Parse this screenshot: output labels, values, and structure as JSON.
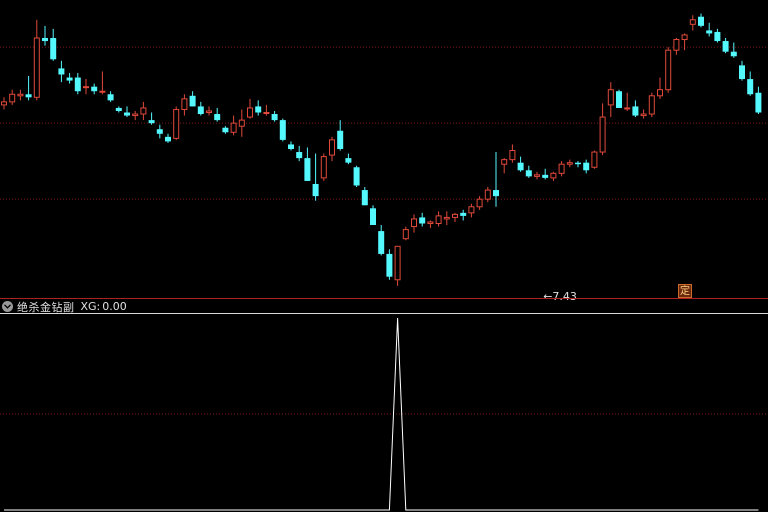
{
  "theme": {
    "background": "#000000",
    "up_color": "#e0493a",
    "down_color": "#54f8ff",
    "grid_color": "#7a1a1a",
    "separator_color": "#b02020",
    "signal_color": "#ffffff"
  },
  "indicator": {
    "icon": "chevron-down-icon",
    "name": "绝杀金钻副",
    "value_label": "XG:",
    "value": "0.00"
  },
  "marker": {
    "label": "定"
  },
  "chart_data": [
    {
      "type": "candlestick",
      "annotation": {
        "text": "←7.43",
        "low_value": 7.43,
        "bar_index": 66
      },
      "ohlc": [
        [
          8.62,
          8.67,
          8.59,
          8.64
        ],
        [
          8.64,
          8.72,
          8.62,
          8.69
        ],
        [
          8.68,
          8.72,
          8.65,
          8.69
        ],
        [
          8.69,
          8.81,
          8.65,
          8.67
        ],
        [
          8.67,
          9.18,
          8.65,
          9.06
        ],
        [
          9.06,
          9.14,
          9.01,
          9.04
        ],
        [
          9.06,
          9.12,
          8.91,
          8.92
        ],
        [
          8.86,
          8.91,
          8.77,
          8.82
        ],
        [
          8.8,
          8.83,
          8.76,
          8.78
        ],
        [
          8.8,
          8.83,
          8.69,
          8.71
        ],
        [
          8.74,
          8.79,
          8.69,
          8.74
        ],
        [
          8.74,
          8.76,
          8.69,
          8.71
        ],
        [
          8.71,
          8.84,
          8.69,
          8.71
        ],
        [
          8.69,
          8.71,
          8.64,
          8.65
        ],
        [
          8.6,
          8.61,
          8.57,
          8.58
        ],
        [
          8.57,
          8.61,
          8.54,
          8.55
        ],
        [
          8.55,
          8.58,
          8.52,
          8.56
        ],
        [
          8.56,
          8.64,
          8.52,
          8.6
        ],
        [
          8.52,
          8.57,
          8.49,
          8.5
        ],
        [
          8.46,
          8.49,
          8.4,
          8.43
        ],
        [
          8.41,
          8.43,
          8.37,
          8.38
        ],
        [
          8.4,
          8.61,
          8.39,
          8.59
        ],
        [
          8.59,
          8.69,
          8.55,
          8.66
        ],
        [
          8.68,
          8.71,
          8.61,
          8.61
        ],
        [
          8.61,
          8.64,
          8.55,
          8.56
        ],
        [
          8.57,
          8.61,
          8.55,
          8.58
        ],
        [
          8.56,
          8.6,
          8.51,
          8.52
        ],
        [
          8.47,
          8.48,
          8.43,
          8.44
        ],
        [
          8.44,
          8.55,
          8.42,
          8.5
        ],
        [
          8.48,
          8.59,
          8.41,
          8.52
        ],
        [
          8.54,
          8.66,
          8.53,
          8.6
        ],
        [
          8.61,
          8.65,
          8.55,
          8.57
        ],
        [
          8.57,
          8.62,
          8.55,
          8.57
        ],
        [
          8.56,
          8.58,
          8.51,
          8.52
        ],
        [
          8.52,
          8.53,
          8.38,
          8.39
        ],
        [
          8.36,
          8.38,
          8.32,
          8.33
        ],
        [
          8.31,
          8.35,
          8.25,
          8.27
        ],
        [
          8.27,
          8.34,
          8.12,
          8.12
        ],
        [
          8.1,
          8.3,
          7.99,
          8.02
        ],
        [
          8.14,
          8.3,
          8.12,
          8.28
        ],
        [
          8.29,
          8.41,
          8.25,
          8.39
        ],
        [
          8.45,
          8.52,
          8.32,
          8.33
        ],
        [
          8.27,
          8.3,
          8.23,
          8.24
        ],
        [
          8.21,
          8.22,
          8.08,
          8.09
        ],
        [
          8.06,
          8.08,
          7.96,
          7.96
        ],
        [
          7.94,
          7.96,
          7.83,
          7.83
        ],
        [
          7.79,
          7.83,
          7.63,
          7.64
        ],
        [
          7.64,
          7.67,
          7.47,
          7.49
        ],
        [
          7.47,
          7.69,
          7.43,
          7.69
        ],
        [
          7.74,
          7.82,
          7.73,
          7.8
        ],
        [
          7.82,
          7.9,
          7.78,
          7.87
        ],
        [
          7.88,
          7.91,
          7.82,
          7.84
        ],
        [
          7.84,
          7.86,
          7.81,
          7.85
        ],
        [
          7.84,
          7.92,
          7.82,
          7.89
        ],
        [
          7.87,
          7.92,
          7.83,
          7.88
        ],
        [
          7.88,
          7.91,
          7.85,
          7.9
        ],
        [
          7.91,
          7.93,
          7.86,
          7.89
        ],
        [
          7.91,
          7.97,
          7.88,
          7.95
        ],
        [
          7.95,
          8.02,
          7.93,
          8.0
        ],
        [
          8.0,
          8.08,
          7.98,
          8.06
        ],
        [
          8.06,
          8.31,
          7.95,
          8.02
        ],
        [
          8.23,
          8.27,
          8.17,
          8.26
        ],
        [
          8.26,
          8.36,
          8.24,
          8.32
        ],
        [
          8.24,
          8.28,
          8.18,
          8.19
        ],
        [
          8.19,
          8.22,
          8.14,
          8.15
        ],
        [
          8.15,
          8.18,
          8.13,
          8.16
        ],
        [
          8.16,
          8.2,
          8.13,
          8.14
        ],
        [
          8.14,
          8.18,
          8.12,
          8.17
        ],
        [
          8.17,
          8.25,
          8.15,
          8.23
        ],
        [
          8.23,
          8.26,
          8.21,
          8.24
        ],
        [
          8.24,
          8.25,
          8.21,
          8.23
        ],
        [
          8.24,
          8.26,
          8.17,
          8.19
        ],
        [
          8.21,
          8.32,
          8.2,
          8.31
        ],
        [
          8.31,
          8.63,
          8.29,
          8.54
        ],
        [
          8.62,
          8.77,
          8.54,
          8.72
        ],
        [
          8.71,
          8.72,
          8.6,
          8.6
        ],
        [
          8.6,
          8.7,
          8.58,
          8.6
        ],
        [
          8.61,
          8.65,
          8.54,
          8.55
        ],
        [
          8.55,
          8.59,
          8.53,
          8.56
        ],
        [
          8.56,
          8.7,
          8.54,
          8.68
        ],
        [
          8.68,
          8.8,
          8.66,
          8.72
        ],
        [
          8.72,
          9.0,
          8.7,
          8.98
        ],
        [
          8.98,
          9.06,
          8.95,
          9.05
        ],
        [
          9.05,
          9.09,
          8.98,
          9.08
        ],
        [
          9.15,
          9.21,
          9.11,
          9.18
        ],
        [
          9.2,
          9.22,
          9.13,
          9.14
        ],
        [
          9.11,
          9.16,
          9.07,
          9.09
        ],
        [
          9.1,
          9.12,
          9.03,
          9.04
        ],
        [
          9.04,
          9.06,
          8.96,
          8.97
        ],
        [
          8.97,
          9.03,
          8.93,
          8.94
        ],
        [
          8.88,
          8.91,
          8.78,
          8.79
        ],
        [
          8.79,
          8.84,
          8.68,
          8.69
        ],
        [
          8.7,
          8.74,
          8.56,
          8.57
        ]
      ],
      "ylim": [
        7.35,
        9.31
      ],
      "grid_values": [
        8.0,
        8.5,
        9.0
      ]
    },
    {
      "type": "line",
      "name": "XG",
      "values": [
        0,
        0,
        0,
        0,
        0,
        0,
        0,
        0,
        0,
        0,
        0,
        0,
        0,
        0,
        0,
        0,
        0,
        0,
        0,
        0,
        0,
        0,
        0,
        0,
        0,
        0,
        0,
        0,
        0,
        0,
        0,
        0,
        0,
        0,
        0,
        0,
        0,
        0,
        0,
        0,
        0,
        0,
        0,
        0,
        0,
        0,
        0,
        0,
        1,
        0,
        0,
        0,
        0,
        0,
        0,
        0,
        0,
        0,
        0,
        0,
        0,
        0,
        0,
        0,
        0,
        0,
        0,
        0,
        0,
        0,
        0,
        0,
        0,
        0,
        0,
        0,
        0,
        0,
        0,
        0,
        0,
        0,
        0,
        0,
        0,
        0,
        0,
        0,
        0,
        0,
        0,
        0,
        0
      ],
      "ylim": [
        0,
        1.0
      ],
      "grid_values": [
        0.5
      ]
    }
  ]
}
